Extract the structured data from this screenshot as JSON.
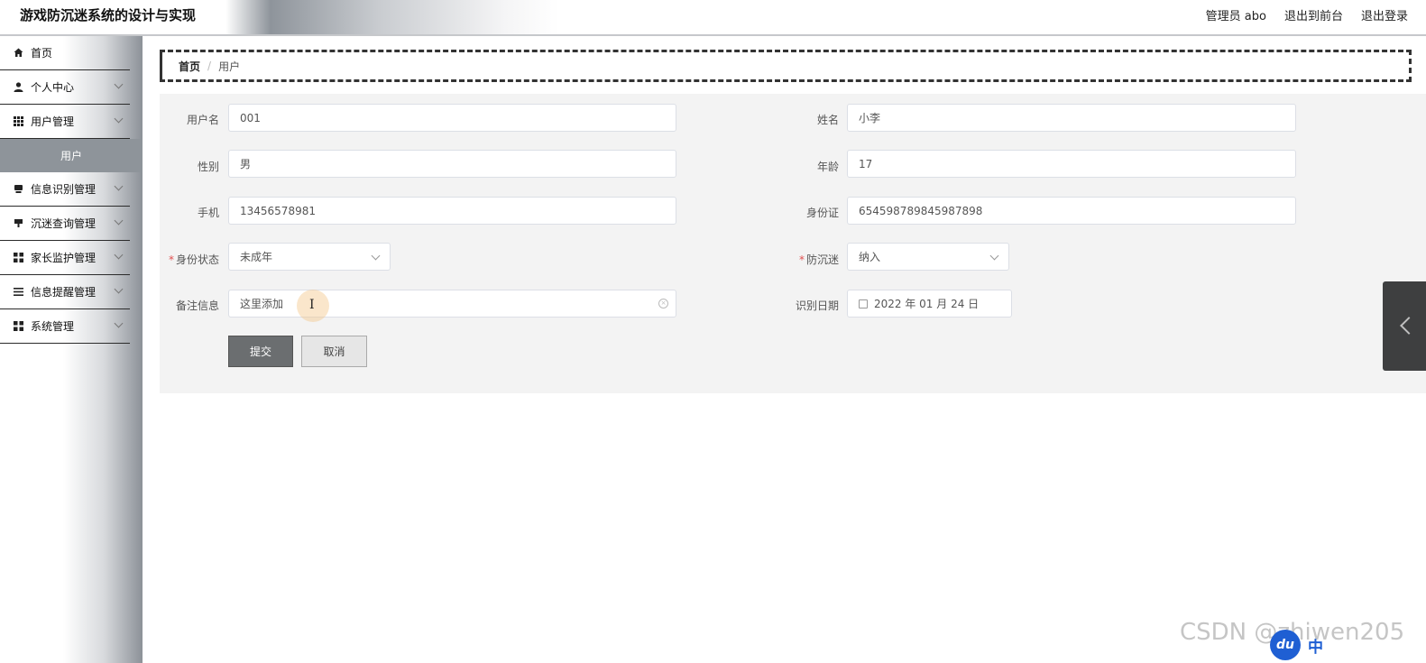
{
  "header": {
    "title": "游戏防沉迷系统的设计与实现",
    "user_label": "管理员 abo",
    "front_link": "退出到前台",
    "logout_link": "退出登录"
  },
  "sidebar": {
    "items": [
      {
        "label": "首页",
        "icon": "home-icon"
      },
      {
        "label": "个人中心",
        "icon": "user-icon"
      },
      {
        "label": "用户管理",
        "icon": "grid-icon"
      },
      {
        "label": "信息识别管理",
        "icon": "monitor-icon"
      },
      {
        "label": "沉迷查询管理",
        "icon": "monitor-icon"
      },
      {
        "label": "家长监护管理",
        "icon": "tiles-icon"
      },
      {
        "label": "信息提醒管理",
        "icon": "list-icon"
      },
      {
        "label": "系统管理",
        "icon": "tiles-icon"
      }
    ],
    "active_sub": "用户"
  },
  "breadcrumb": {
    "home": "首页",
    "separator": "/",
    "current": "用户"
  },
  "form": {
    "username_label": "用户名",
    "username_value": "001",
    "name_label": "姓名",
    "name_value": "小李",
    "gender_label": "性别",
    "gender_value": "男",
    "age_label": "年龄",
    "age_value": "17",
    "phone_label": "手机",
    "phone_value": "13456578981",
    "idcard_label": "身份证",
    "idcard_value": "654598789845987898",
    "status_label": "身份状态",
    "status_value": "未成年",
    "anti_label": "防沉迷",
    "anti_value": "纳入",
    "remark_label": "备注信息",
    "remark_value": "这里添加",
    "date_label": "识别日期",
    "date_value": "2022 年 01 月 24 日",
    "required_mark": "*",
    "submit": "提交",
    "cancel": "取消"
  },
  "watermark": "CSDN @zhiwen205",
  "ime": {
    "logo": "du",
    "text": "中"
  }
}
